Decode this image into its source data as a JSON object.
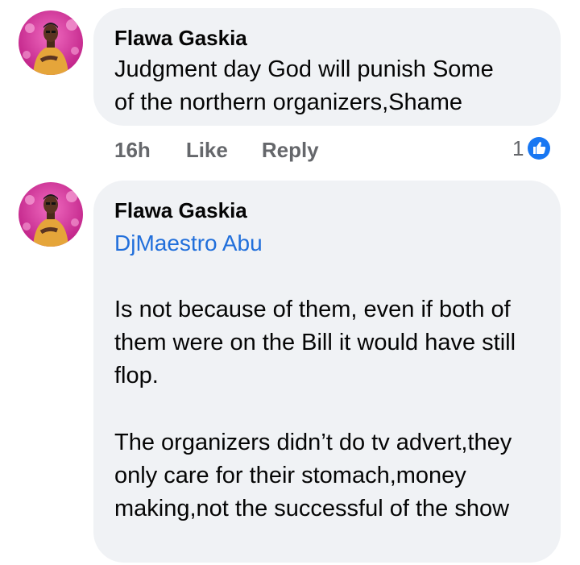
{
  "comments": [
    {
      "author": "Flawa Gaskia",
      "text": "Judgment day God will punish Some\nof the northern organizers,Shame",
      "time": "16h",
      "like_label": "Like",
      "reply_label": "Reply",
      "reaction_count": "1",
      "reaction_icon": "thumbs-up-icon",
      "reaction_color": "#1877f2"
    },
    {
      "author": "Flawa Gaskia",
      "mention": "DjMaestro Abu",
      "paragraphs": [
        "Is not because of them, even if both of them were on the Bill it would have still flop.",
        "The organizers didn’t do tv advert,they only care for their stomach,money making,not the successful of the show"
      ]
    }
  ],
  "colors": {
    "bubble_bg": "#f0f2f5",
    "mention": "#216fdb",
    "meta_text": "#65676b",
    "avatar_bg": "#d6369b",
    "shirt": "#e5a53a"
  }
}
